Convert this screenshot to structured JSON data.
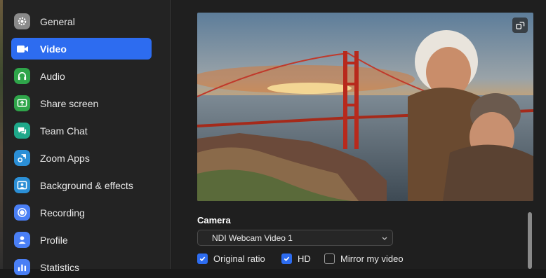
{
  "sidebar": {
    "items": [
      {
        "label": "General",
        "icon": "gear-icon",
        "color": "#8a8a8a",
        "active": false
      },
      {
        "label": "Video",
        "icon": "video-camera-icon",
        "color": "#2d6cf0",
        "active": true
      },
      {
        "label": "Audio",
        "icon": "headphones-icon",
        "color": "#2fa54a",
        "active": false
      },
      {
        "label": "Share screen",
        "icon": "share-screen-icon",
        "color": "#2fa54a",
        "active": false
      },
      {
        "label": "Team Chat",
        "icon": "chat-icon",
        "color": "#1fa88a",
        "active": false
      },
      {
        "label": "Zoom Apps",
        "icon": "apps-icon",
        "color": "#2b8fd6",
        "active": false
      },
      {
        "label": "Background & effects",
        "icon": "background-icon",
        "color": "#2b8fd6",
        "active": false
      },
      {
        "label": "Recording",
        "icon": "recording-icon",
        "color": "#2d6cf0",
        "active": false
      },
      {
        "label": "Profile",
        "icon": "profile-icon",
        "color": "#2d6cf0",
        "active": false
      },
      {
        "label": "Statistics",
        "icon": "statistics-icon",
        "color": "#2d6cf0",
        "active": false
      }
    ]
  },
  "camera": {
    "label": "Camera",
    "selected": "NDI Webcam Video 1"
  },
  "options": [
    {
      "label": "Original ratio",
      "checked": true
    },
    {
      "label": "HD",
      "checked": true
    },
    {
      "label": "Mirror my video",
      "checked": false
    }
  ],
  "accent": "#2d6cf0"
}
